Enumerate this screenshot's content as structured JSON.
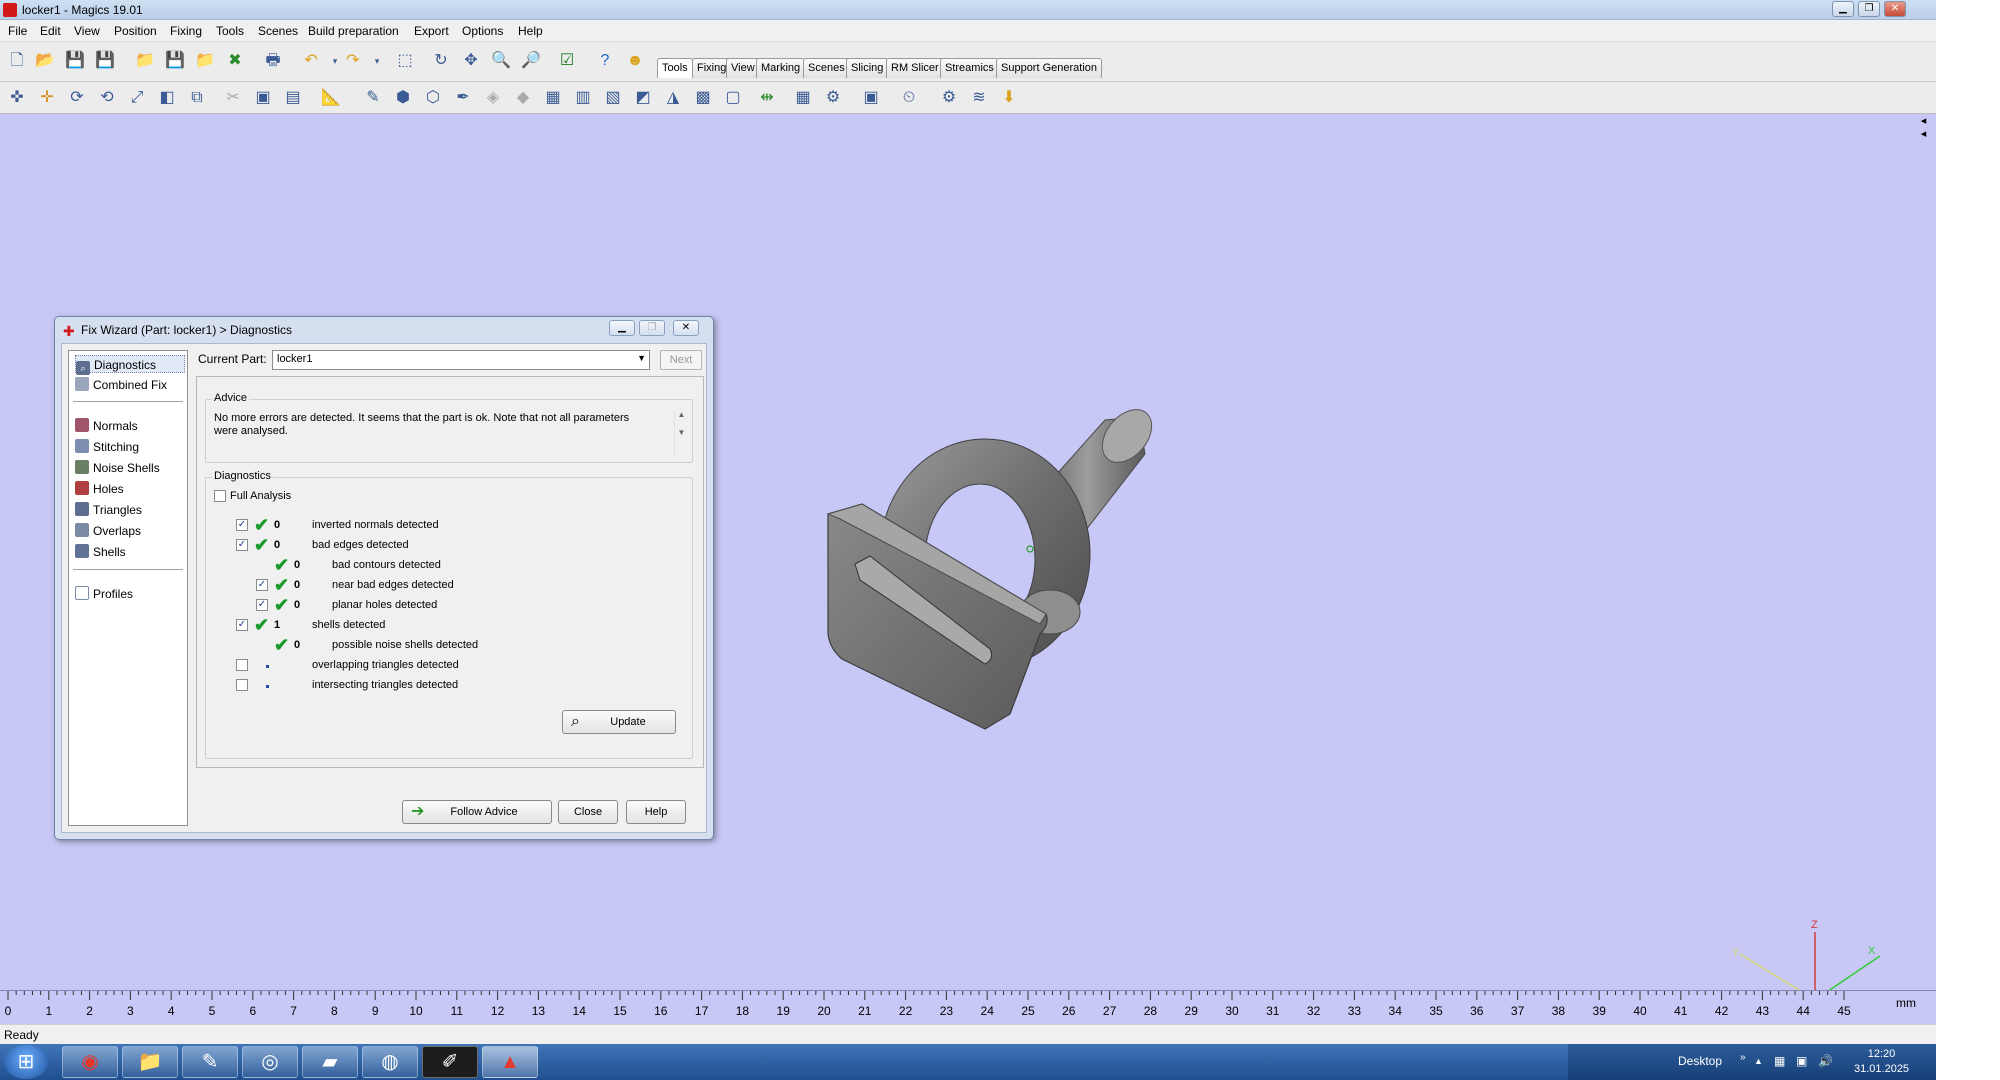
{
  "window": {
    "title": "locker1 - Magics 19.01"
  },
  "menu": [
    "File",
    "Edit",
    "View",
    "Position",
    "Fixing",
    "Tools",
    "Scenes",
    "Build preparation",
    "Export",
    "Options",
    "Help"
  ],
  "toolbar_tabs": [
    "Tools",
    "Fixing",
    "View",
    "Marking",
    "Scenes",
    "Slicing",
    "RM Slicer",
    "Streamics",
    "Support Generation"
  ],
  "active_tab": "Tools",
  "dialog": {
    "title": "Fix Wizard (Part: locker1) > Diagnostics",
    "nav": {
      "items_top": [
        "Diagnostics",
        "Combined Fix"
      ],
      "items_mid": [
        "Normals",
        "Stitching",
        "Noise Shells",
        "Holes",
        "Triangles",
        "Overlaps",
        "Shells"
      ],
      "items_bottom": [
        "Profiles"
      ]
    },
    "current_part_label": "Current Part:",
    "current_part_value": "locker1",
    "next_label": "Next",
    "advice_title": "Advice",
    "advice_text": "No more errors are detected. It seems that the part is ok. Note that not all parameters were analysed.",
    "diagnostics_title": "Diagnostics",
    "full_analysis_label": "Full Analysis",
    "rows": [
      {
        "checked": true,
        "status": "ok",
        "count": "0",
        "label": "inverted normals detected"
      },
      {
        "checked": true,
        "status": "ok",
        "count": "0",
        "label": "bad edges detected"
      },
      {
        "checked": null,
        "status": "ok",
        "count": "0",
        "label": "bad contours detected"
      },
      {
        "checked": true,
        "status": "ok",
        "count": "0",
        "label": "near bad edges detected"
      },
      {
        "checked": true,
        "status": "ok",
        "count": "0",
        "label": "planar holes detected"
      },
      {
        "checked": true,
        "status": "ok",
        "count": "1",
        "label": "shells detected"
      },
      {
        "checked": null,
        "status": "ok",
        "count": "0",
        "label": "possible noise shells detected"
      },
      {
        "checked": false,
        "status": "none",
        "count": "",
        "label": "overlapping triangles detected"
      },
      {
        "checked": false,
        "status": "none",
        "count": "",
        "label": "intersecting triangles detected"
      }
    ],
    "update_label": "Update",
    "follow_advice_label": "Follow Advice",
    "close_label": "Close",
    "help_label": "Help"
  },
  "ruler": {
    "ticks": [
      "0",
      "1",
      "2",
      "3",
      "4",
      "5",
      "6",
      "7",
      "8",
      "9",
      "10",
      "11",
      "12",
      "13",
      "14",
      "15",
      "16",
      "17",
      "18",
      "19",
      "20",
      "21",
      "22",
      "23",
      "24",
      "25",
      "26",
      "27",
      "28",
      "29",
      "30",
      "31",
      "32",
      "33",
      "34",
      "35",
      "36",
      "37",
      "38",
      "39",
      "40",
      "41",
      "42",
      "43",
      "44",
      "45"
    ],
    "unit": "mm"
  },
  "axes": {
    "x": "X",
    "y": "Y",
    "z": "Z"
  },
  "status": "Ready",
  "taskbar": {
    "desktop_label": "Desktop",
    "time": "12:20",
    "date": "31.01.2025"
  },
  "colors": {
    "viewport_bg": "#c8c8f6",
    "model": "#7a7a7a",
    "ok_tick": "#1a9a2a",
    "axis_x": "#33cc33",
    "axis_y": "#d9d97a",
    "axis_z": "#d63a3a"
  }
}
